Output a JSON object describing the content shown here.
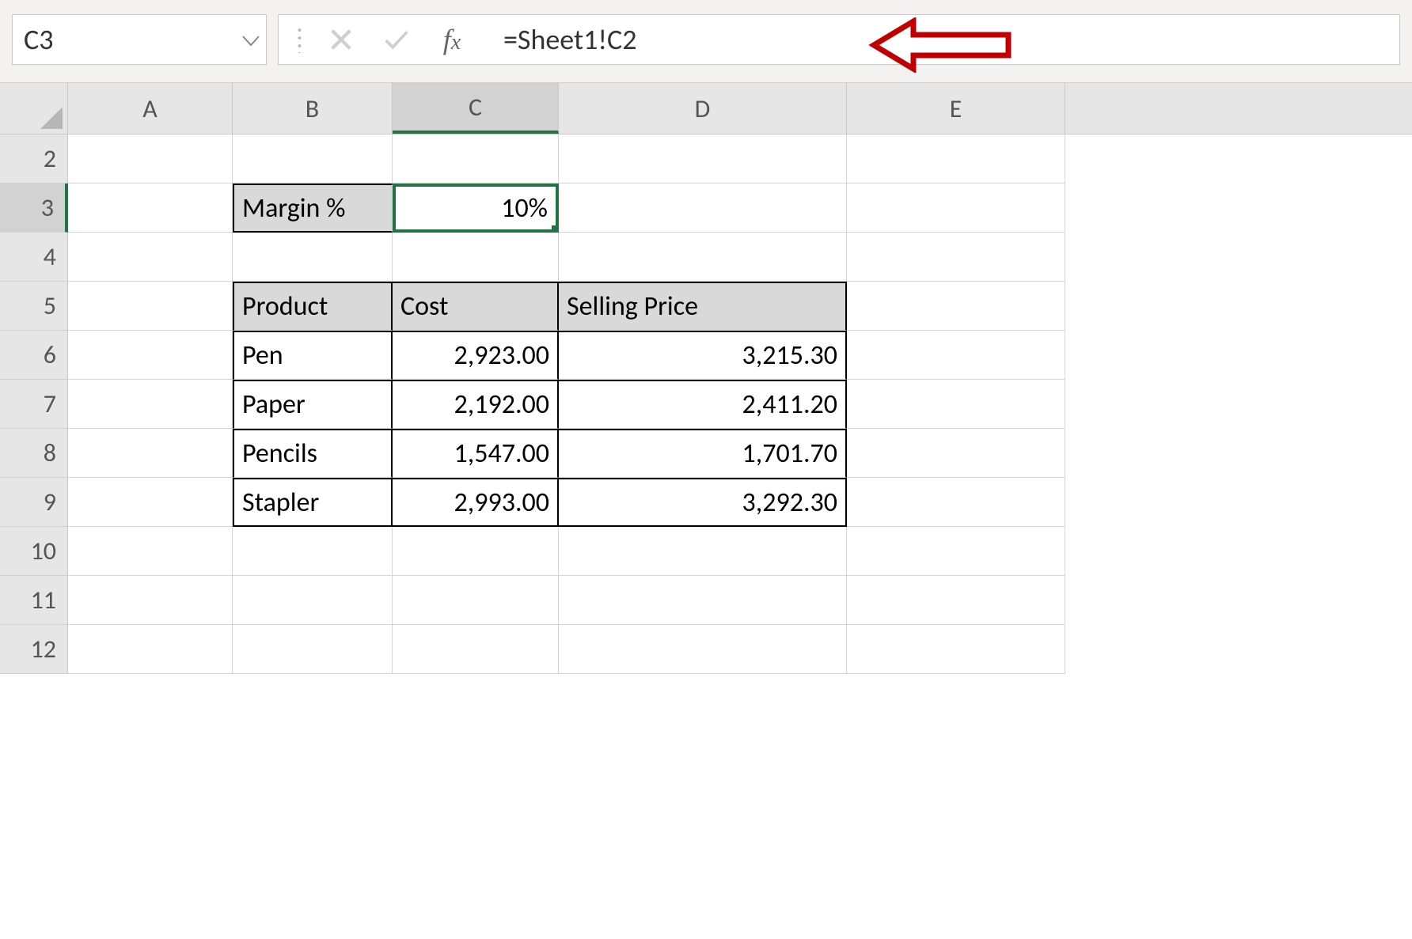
{
  "name_box": "C3",
  "formula_bar": "=Sheet1!C2",
  "columns": [
    "A",
    "B",
    "C",
    "D",
    "E"
  ],
  "rows": [
    "2",
    "3",
    "4",
    "5",
    "6",
    "7",
    "8",
    "9",
    "10",
    "11",
    "12"
  ],
  "margin": {
    "label": "Margin %",
    "value": "10%"
  },
  "table": {
    "headers": [
      "Product",
      "Cost",
      "Selling Price"
    ],
    "rows": [
      {
        "product": "Pen",
        "cost": "2,923.00",
        "price": "3,215.30"
      },
      {
        "product": "Paper",
        "cost": "2,192.00",
        "price": "2,411.20"
      },
      {
        "product": "Pencils",
        "cost": "1,547.00",
        "price": "1,701.70"
      },
      {
        "product": "Stapler",
        "cost": "2,993.00",
        "price": "3,292.30"
      }
    ]
  }
}
